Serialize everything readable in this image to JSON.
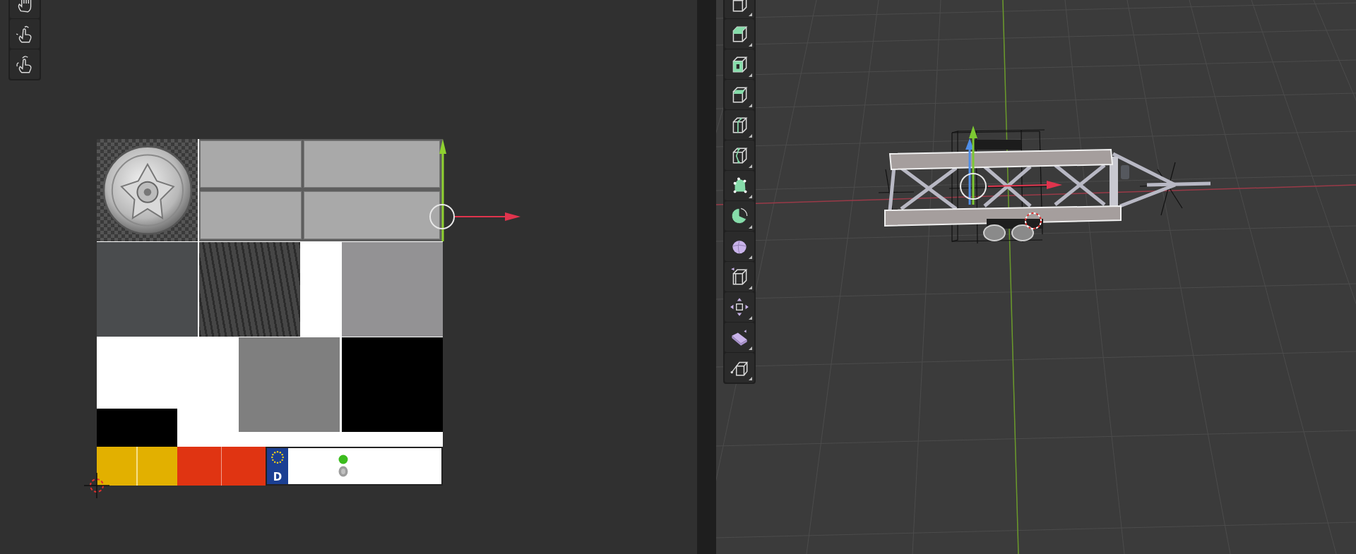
{
  "uv_editor": {
    "toolbar": [
      {
        "kind": "grab"
      },
      {
        "kind": "pinch"
      },
      {
        "kind": "twist"
      }
    ],
    "texture": {
      "plate_letter": "D"
    }
  },
  "viewport": {
    "toolbar": [
      {
        "kind": "cube"
      },
      {
        "kind": "extrude"
      },
      {
        "kind": "inset"
      },
      {
        "kind": "bevel"
      },
      {
        "kind": "loopcut"
      },
      {
        "kind": "knife"
      },
      {
        "kind": "polybuild"
      },
      {
        "kind": "spin"
      },
      {
        "kind": "smooth"
      },
      {
        "kind": "edgeslide"
      },
      {
        "kind": "shrink"
      },
      {
        "kind": "shear"
      },
      {
        "kind": "rip"
      }
    ]
  }
}
